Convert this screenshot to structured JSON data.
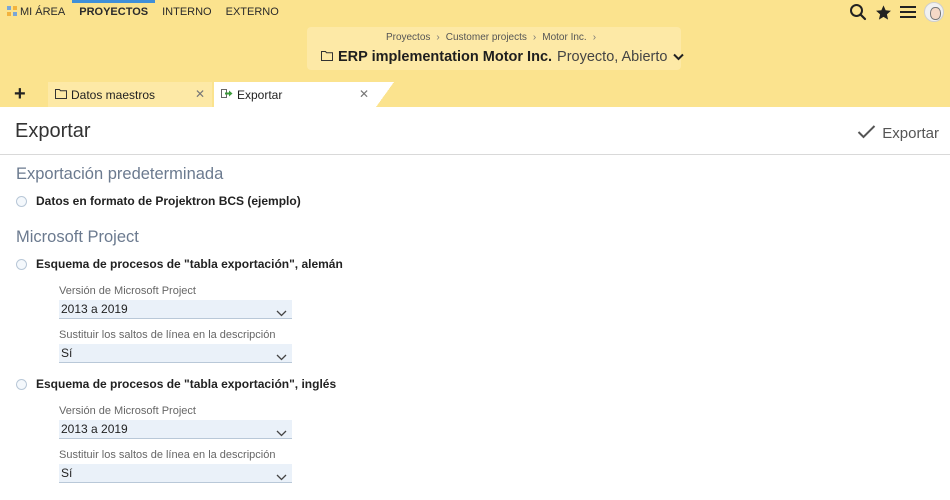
{
  "nav": {
    "items": [
      {
        "label": "MI ÁREA",
        "active": false
      },
      {
        "label": "PROYECTOS",
        "active": true
      },
      {
        "label": "INTERNO",
        "active": false
      },
      {
        "label": "EXTERNO",
        "active": false
      }
    ]
  },
  "top_icons": [
    "search-icon",
    "star-icon",
    "menu-icon",
    "avatar"
  ],
  "project": {
    "breadcrumb": [
      "Proyectos",
      "Customer projects",
      "Motor Inc."
    ],
    "title": "ERP implementation Motor Inc.",
    "status": "Proyecto, Abierto"
  },
  "tabs": [
    {
      "label": "Datos maestros",
      "icon": "folder-icon"
    },
    {
      "label": "Exportar",
      "icon": "export-arrow-icon"
    }
  ],
  "page": {
    "title": "Exportar",
    "action_label": "Exportar"
  },
  "sections": {
    "default": {
      "title": "Exportación predeterminada",
      "option": "Datos en formato de Projektron BCS (ejemplo)"
    },
    "msproject": {
      "title": "Microsoft Project",
      "options": [
        {
          "label": "Esquema de procesos de \"tabla exportación\", alemán",
          "version_label": "Versión de Microsoft Project",
          "version_value": "2013 a 2019",
          "linebreak_label": "Sustituir los saltos de línea en la descripción",
          "linebreak_value": "Sí"
        },
        {
          "label": "Esquema de procesos de \"tabla exportación\", inglés",
          "version_label": "Versión de Microsoft Project",
          "version_value": "2013 a 2019",
          "linebreak_label": "Sustituir los saltos de línea en la descripción",
          "linebreak_value": "Sí"
        }
      ]
    }
  },
  "colors": {
    "header_bg": "#fbe38e",
    "accent": "#3f8fd8",
    "section_title": "#6b7a8f",
    "field_bg": "#eaf1f9"
  }
}
